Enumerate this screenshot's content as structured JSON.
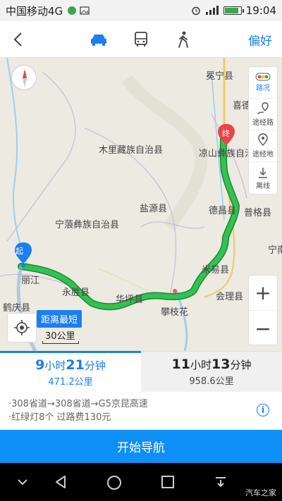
{
  "status_bar": {
    "carrier": "中国移动4G",
    "time": "19:04"
  },
  "header": {
    "preference_label": "偏好",
    "modes": [
      "car-icon",
      "bus-icon",
      "walk-icon"
    ]
  },
  "map": {
    "labels": {
      "mianning": "冕宁县",
      "xide": "喜德",
      "muli": "木里藏族自治县",
      "liangshan": "凉山彝族自治",
      "yanyuan": "盐源县",
      "ninglang": "宁蒗彝族自治县",
      "dechang": "德昌县",
      "puge": "普格县",
      "ningnan": "宁南",
      "miyi": "米易县",
      "lijiang": "丽江",
      "yongsheng": "永胜县",
      "huaping": "华坪县",
      "panzhihua": "攀枝花",
      "huili": "会理县",
      "heqing": "鹤庆县"
    },
    "start_marker": "起",
    "end_marker": "终",
    "side_panel": [
      "路况",
      "途经路",
      "途经地",
      "离线"
    ],
    "callout": "距离最短",
    "scale": "30公里"
  },
  "routes": [
    {
      "time_h": "9",
      "h_unit": "小时",
      "time_m": "21",
      "m_unit": "分钟",
      "distance": "471.2公里"
    },
    {
      "time_h": "11",
      "h_unit": "小时",
      "time_m": "13",
      "m_unit": "分钟",
      "distance": "958.6公里"
    }
  ],
  "route_info": {
    "roads": "·308省道→308省道→G5京昆高速",
    "details": "·红绿灯8个  过路费130元"
  },
  "start_nav_label": "开始导航",
  "watermark": "汽车之家",
  "colors": {
    "accent": "#1a7ff0",
    "route": "#2db84a",
    "start_button": "#0d8ff5"
  }
}
